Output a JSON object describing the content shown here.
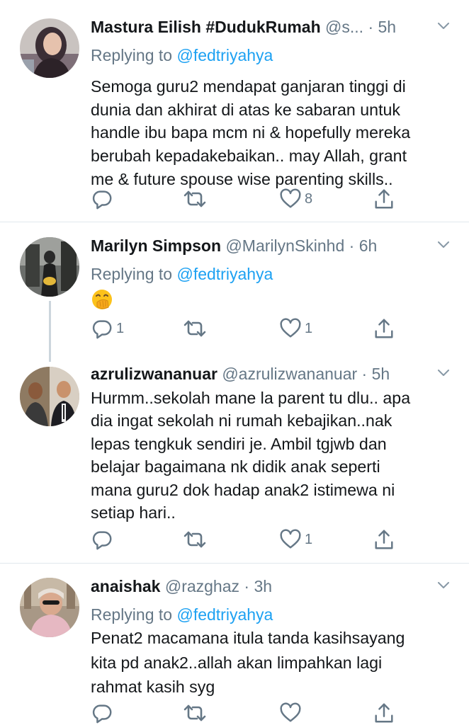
{
  "tweets": [
    {
      "name": "Mastura Eilish #DudukRumah",
      "handle": "@s...",
      "time": "5h",
      "replying_prefix": "Replying to ",
      "replying_to": "@fedtriyahya",
      "text_lines": [
        "Semoga guru2 mendapat ganjaran tinggi di",
        "dunia dan akhirat di atas ke sabaran untuk",
        "handle ibu bapa mcm ni & hopefully mereka",
        "berubah kepadakebaikan.. may Allah, grant",
        "me & future spouse wise parenting skills.."
      ],
      "reply_count": "",
      "retweet_count": "",
      "like_count": "8"
    },
    {
      "name": "Marilyn Simpson",
      "handle": "@MarilynSkinhd",
      "time": "6h",
      "replying_prefix": "Replying to ",
      "replying_to": "@fedtriyahya",
      "emoji": "hand-over-mouth-emoji",
      "reply_count": "1",
      "retweet_count": "",
      "like_count": "1"
    },
    {
      "name": "azrulizwananuar",
      "handle": "@azrulizwananuar",
      "time": "5h",
      "text_lines": [
        "Hurmm..sekolah mane la parent tu dlu.. apa",
        "dia ingat sekolah ni rumah kebajikan..nak",
        "lepas tengkuk sendiri je. Ambil tgjwb dan",
        "belajar bagaimana nk didik anak seperti",
        "mana guru2 dok hadap anak2 istimewa ni",
        "setiap hari.."
      ],
      "reply_count": "",
      "retweet_count": "",
      "like_count": "1"
    },
    {
      "name": "anaishak",
      "handle": "@razghaz",
      "time": "3h",
      "replying_prefix": "Replying to ",
      "replying_to": "@fedtriyahya",
      "text_lines": [
        "Penat2 macamana itula tanda kasihsayang",
        "kita pd anak2..allah akan limpahkan lagi",
        "rahmat kasih syg"
      ],
      "reply_count": "",
      "retweet_count": "",
      "like_count": ""
    }
  ],
  "separator": "·",
  "icons": {
    "reply": "reply-icon",
    "retweet": "retweet-icon",
    "like": "heart-icon",
    "share": "share-icon",
    "more": "chevron-down-icon"
  },
  "colors": {
    "text": "#14171a",
    "secondary": "#657786",
    "link": "#1da1f2",
    "divider": "#e1e8ed",
    "thread_line": "#ccd6dd"
  }
}
